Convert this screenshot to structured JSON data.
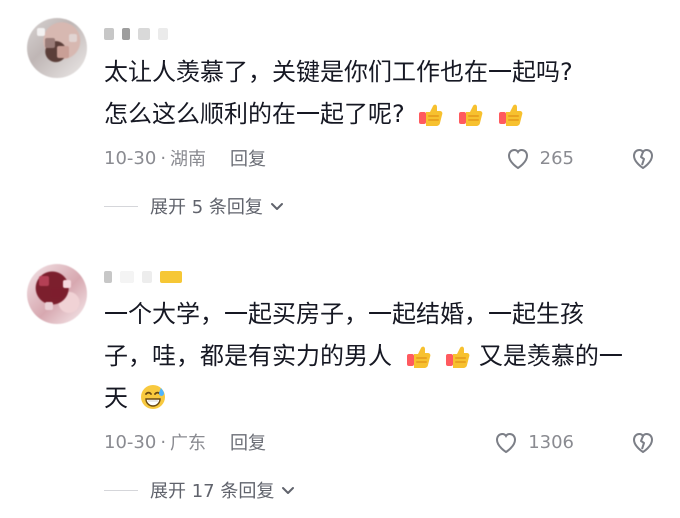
{
  "comments": [
    {
      "text_lines": [
        "太让人羡慕了，关键是你们工作也在一起吗?",
        "怎么这么顺利的在一起了呢?"
      ],
      "emoji": [
        "thumbs-up",
        "thumbs-up",
        "thumbs-up"
      ],
      "date": "10-30",
      "location": "湖南",
      "reply_label": "回复",
      "like_count": "265",
      "expand_label": "展开 5 条回复"
    },
    {
      "text_lines": [
        "一个大学，一起买房子，一起结婚，一起生孩",
        "子，哇，都是有实力的男人",
        "又是羡慕的一",
        "天"
      ],
      "emoji": [
        "thumbs-up",
        "thumbs-up",
        "grinning-sweat"
      ],
      "date": "10-30",
      "location": "广东",
      "reply_label": "回复",
      "like_count": "1306",
      "expand_label": "展开 17 条回复"
    }
  ],
  "colors": {
    "text_primary": "#161823",
    "text_secondary": "#8a8b91",
    "divider": "#d5d6da",
    "thumb_yellow": "#f7c12f",
    "thumb_shadow": "#e9a31f",
    "thumb_cuff": "#ff5a5f"
  },
  "icons": {
    "avatar_placeholder": "avatar",
    "like": "heart-icon",
    "dislike": "broken-heart-icon",
    "expand": "chevron-down-icon",
    "thumbs_up": "thumbs-up-emoji",
    "smile": "grinning-sweat-emoji"
  }
}
